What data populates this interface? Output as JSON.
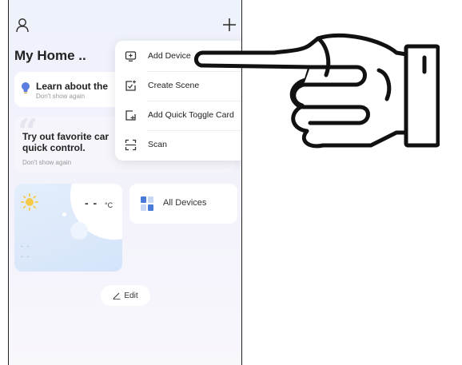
{
  "header": {
    "title": "My Home ..",
    "user_icon": "user-icon",
    "add_icon": "plus-icon"
  },
  "tips": {
    "learn": {
      "title": "Learn about the",
      "dismiss": "Don't show again",
      "icon": "lightbulb-icon"
    },
    "try_out": {
      "title": "Try out favorite car quick control.",
      "dismiss": "Don't show again"
    }
  },
  "weather": {
    "icon": "sun-icon",
    "temperature": "- -",
    "unit": "°C",
    "line1": "- -",
    "line2": "- -"
  },
  "devices": {
    "label": "All Devices",
    "icon": "devices-grid-icon"
  },
  "edit": {
    "label": "Edit",
    "icon": "pencil-icon"
  },
  "menu": {
    "items": [
      {
        "label": "Add Device",
        "icon": "add-device-icon"
      },
      {
        "label": "Create Scene",
        "icon": "create-scene-icon"
      },
      {
        "label": "Add Quick Toggle Card",
        "icon": "add-card-icon"
      },
      {
        "label": "Scan",
        "icon": "scan-icon"
      }
    ]
  },
  "overlay": {
    "icon": "pointing-hand-icon"
  },
  "colors": {
    "accent_blue": "#4a7bd8",
    "sun_yellow": "#f7c948",
    "bulb_blue": "#5b7fe0",
    "text_dark": "#222222",
    "text_muted": "#999999"
  }
}
